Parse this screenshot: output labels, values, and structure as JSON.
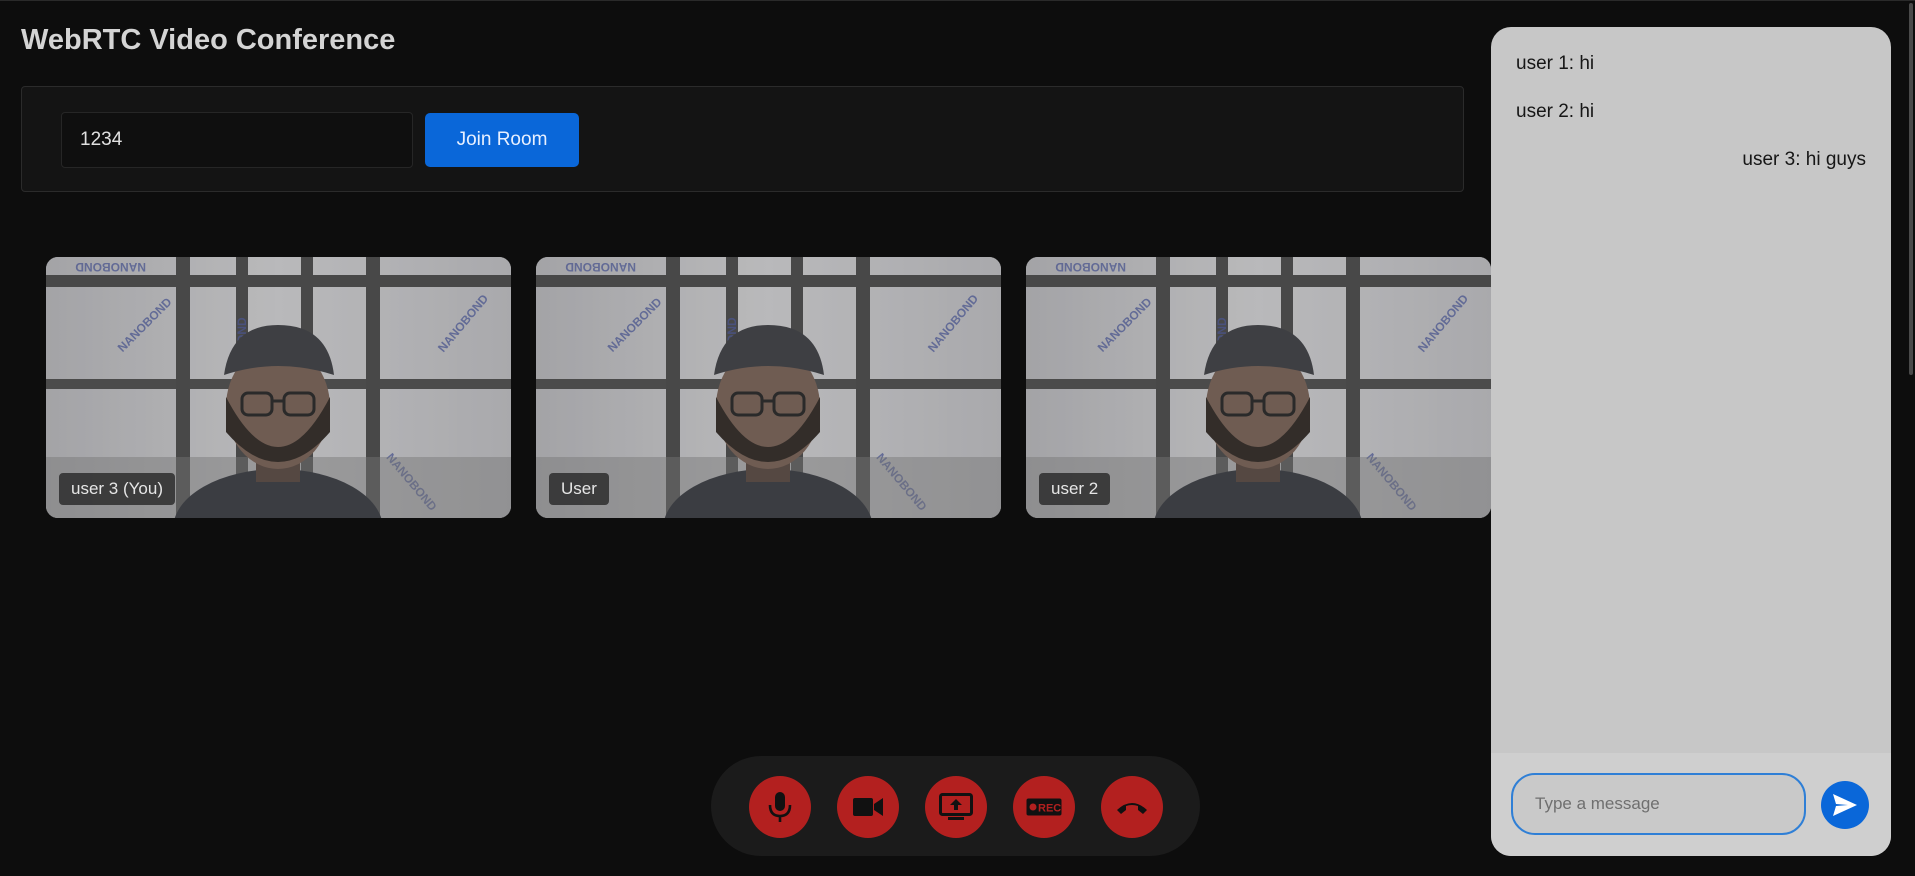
{
  "app": {
    "title": "WebRTC Video Conference"
  },
  "join": {
    "room_value": "1234",
    "button_label": "Join Room"
  },
  "videos": [
    {
      "label": "user 3 (You)"
    },
    {
      "label": "User"
    },
    {
      "label": "user 2"
    }
  ],
  "controls": [
    {
      "name": "microphone",
      "icon": "microphone-icon"
    },
    {
      "name": "camera",
      "icon": "video-camera-icon"
    },
    {
      "name": "share-screen",
      "icon": "screen-share-icon"
    },
    {
      "name": "record",
      "icon": "record-rec-icon",
      "icon_text": "REC"
    },
    {
      "name": "end-call",
      "icon": "hang-up-phone-icon"
    }
  ],
  "chat": {
    "messages": [
      {
        "text": "user 1: hi",
        "align": "left"
      },
      {
        "text": "user 2: hi",
        "align": "left"
      },
      {
        "text": "user 3: hi guys",
        "align": "right"
      }
    ],
    "input_placeholder": "Type a message",
    "send_icon": "send-icon"
  },
  "colors": {
    "background": "#0d0d0d",
    "accent": "#0a67d9",
    "control_red": "#b3201f",
    "chat_bg": "#c7c7c7"
  }
}
